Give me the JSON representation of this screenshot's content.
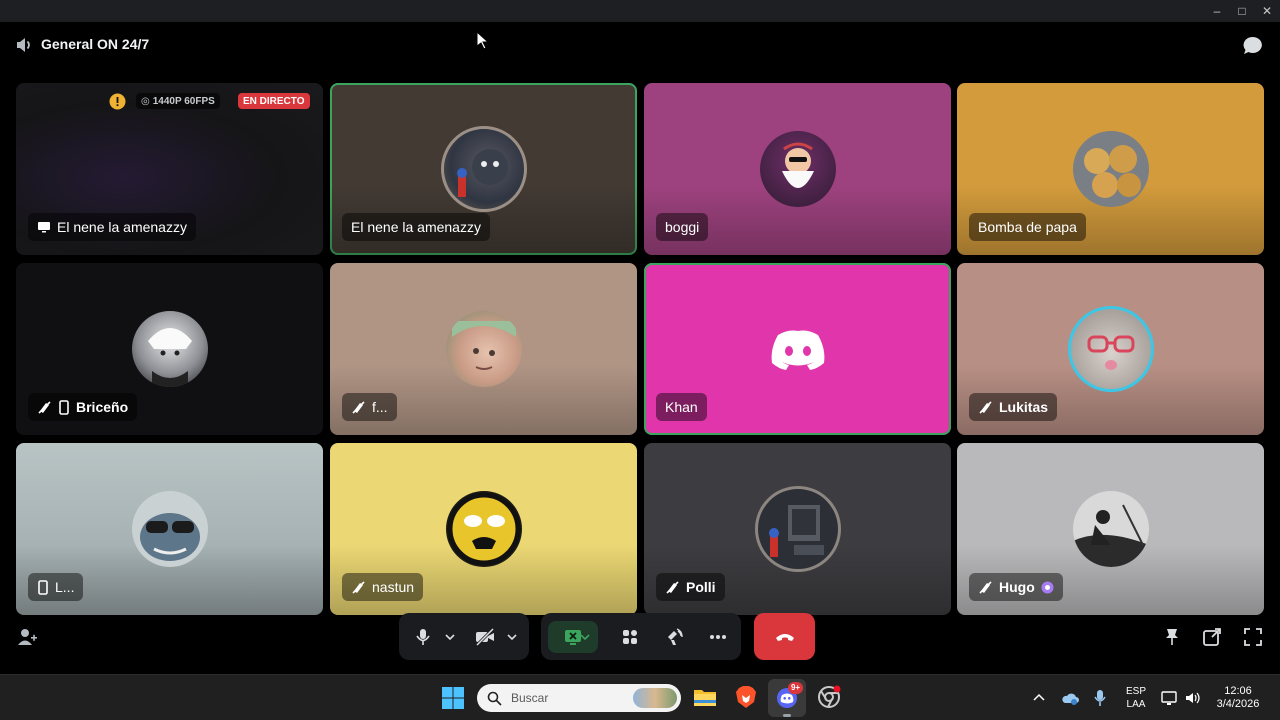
{
  "window": {
    "minimize_icon": "minimize-icon",
    "maximize_icon": "maximize-icon",
    "close_icon": "close-icon"
  },
  "header": {
    "channel_name": "General ON 24/7",
    "channel_icon": "voice-speaker-icon",
    "chat_icon": "chat-bubble-icon"
  },
  "stream": {
    "quality": "1440P 60FPS",
    "live_label": "EN DIRECTO",
    "warning_icon": "warning-icon"
  },
  "participants": [
    {
      "name": "El nene la amenazzy",
      "type": "stream",
      "icon": "screen-share-icon"
    },
    {
      "name": "El nene la amenazzy",
      "type": "camera-off",
      "speaking": true
    },
    {
      "name": "boggi",
      "type": "camera-off"
    },
    {
      "name": "Bomba de papa",
      "type": "camera-off"
    },
    {
      "name": "Briceño",
      "icons": [
        "deafened-icon",
        "mobile-icon"
      ]
    },
    {
      "name": "f...",
      "icons": [
        "deafened-icon"
      ]
    },
    {
      "name": "Khan",
      "speaking": true
    },
    {
      "name": "Lukitas",
      "icons": [
        "deafened-icon"
      ]
    },
    {
      "name": "L...",
      "icons": [
        "mobile-icon"
      ]
    },
    {
      "name": "nastun",
      "icons": [
        "deafened-icon"
      ]
    },
    {
      "name": "Polli",
      "icons": [
        "deafened-icon"
      ]
    },
    {
      "name": "Hugo",
      "icons": [
        "deafened-icon"
      ],
      "badge_icon": "nitro-badge-icon"
    }
  ],
  "toolbar": {
    "left_icon": "add-person-icon",
    "buttons": [
      "microphone-icon",
      "camera-off-icon",
      "screen-share-icon",
      "activities-icon",
      "soundboard-icon",
      "more-icon"
    ],
    "disconnect_icon": "hang-up-icon",
    "right_icons": [
      "pin-icon",
      "popout-icon",
      "fullscreen-icon"
    ]
  },
  "taskbar": {
    "search_placeholder": "Buscar",
    "apps": [
      "windows-start-icon",
      "file-explorer-icon",
      "brave-icon",
      "discord-icon",
      "chrome-icon"
    ],
    "discord_badge": "9+",
    "language_line1": "ESP",
    "language_line2": "LAA",
    "time": "12:06",
    "date": "3/4/2026"
  },
  "colors": {
    "accent_green": "#3ba55d",
    "live_red": "#da373c",
    "discord_blurple": "#5865f2",
    "disconnect": "#da373c"
  }
}
